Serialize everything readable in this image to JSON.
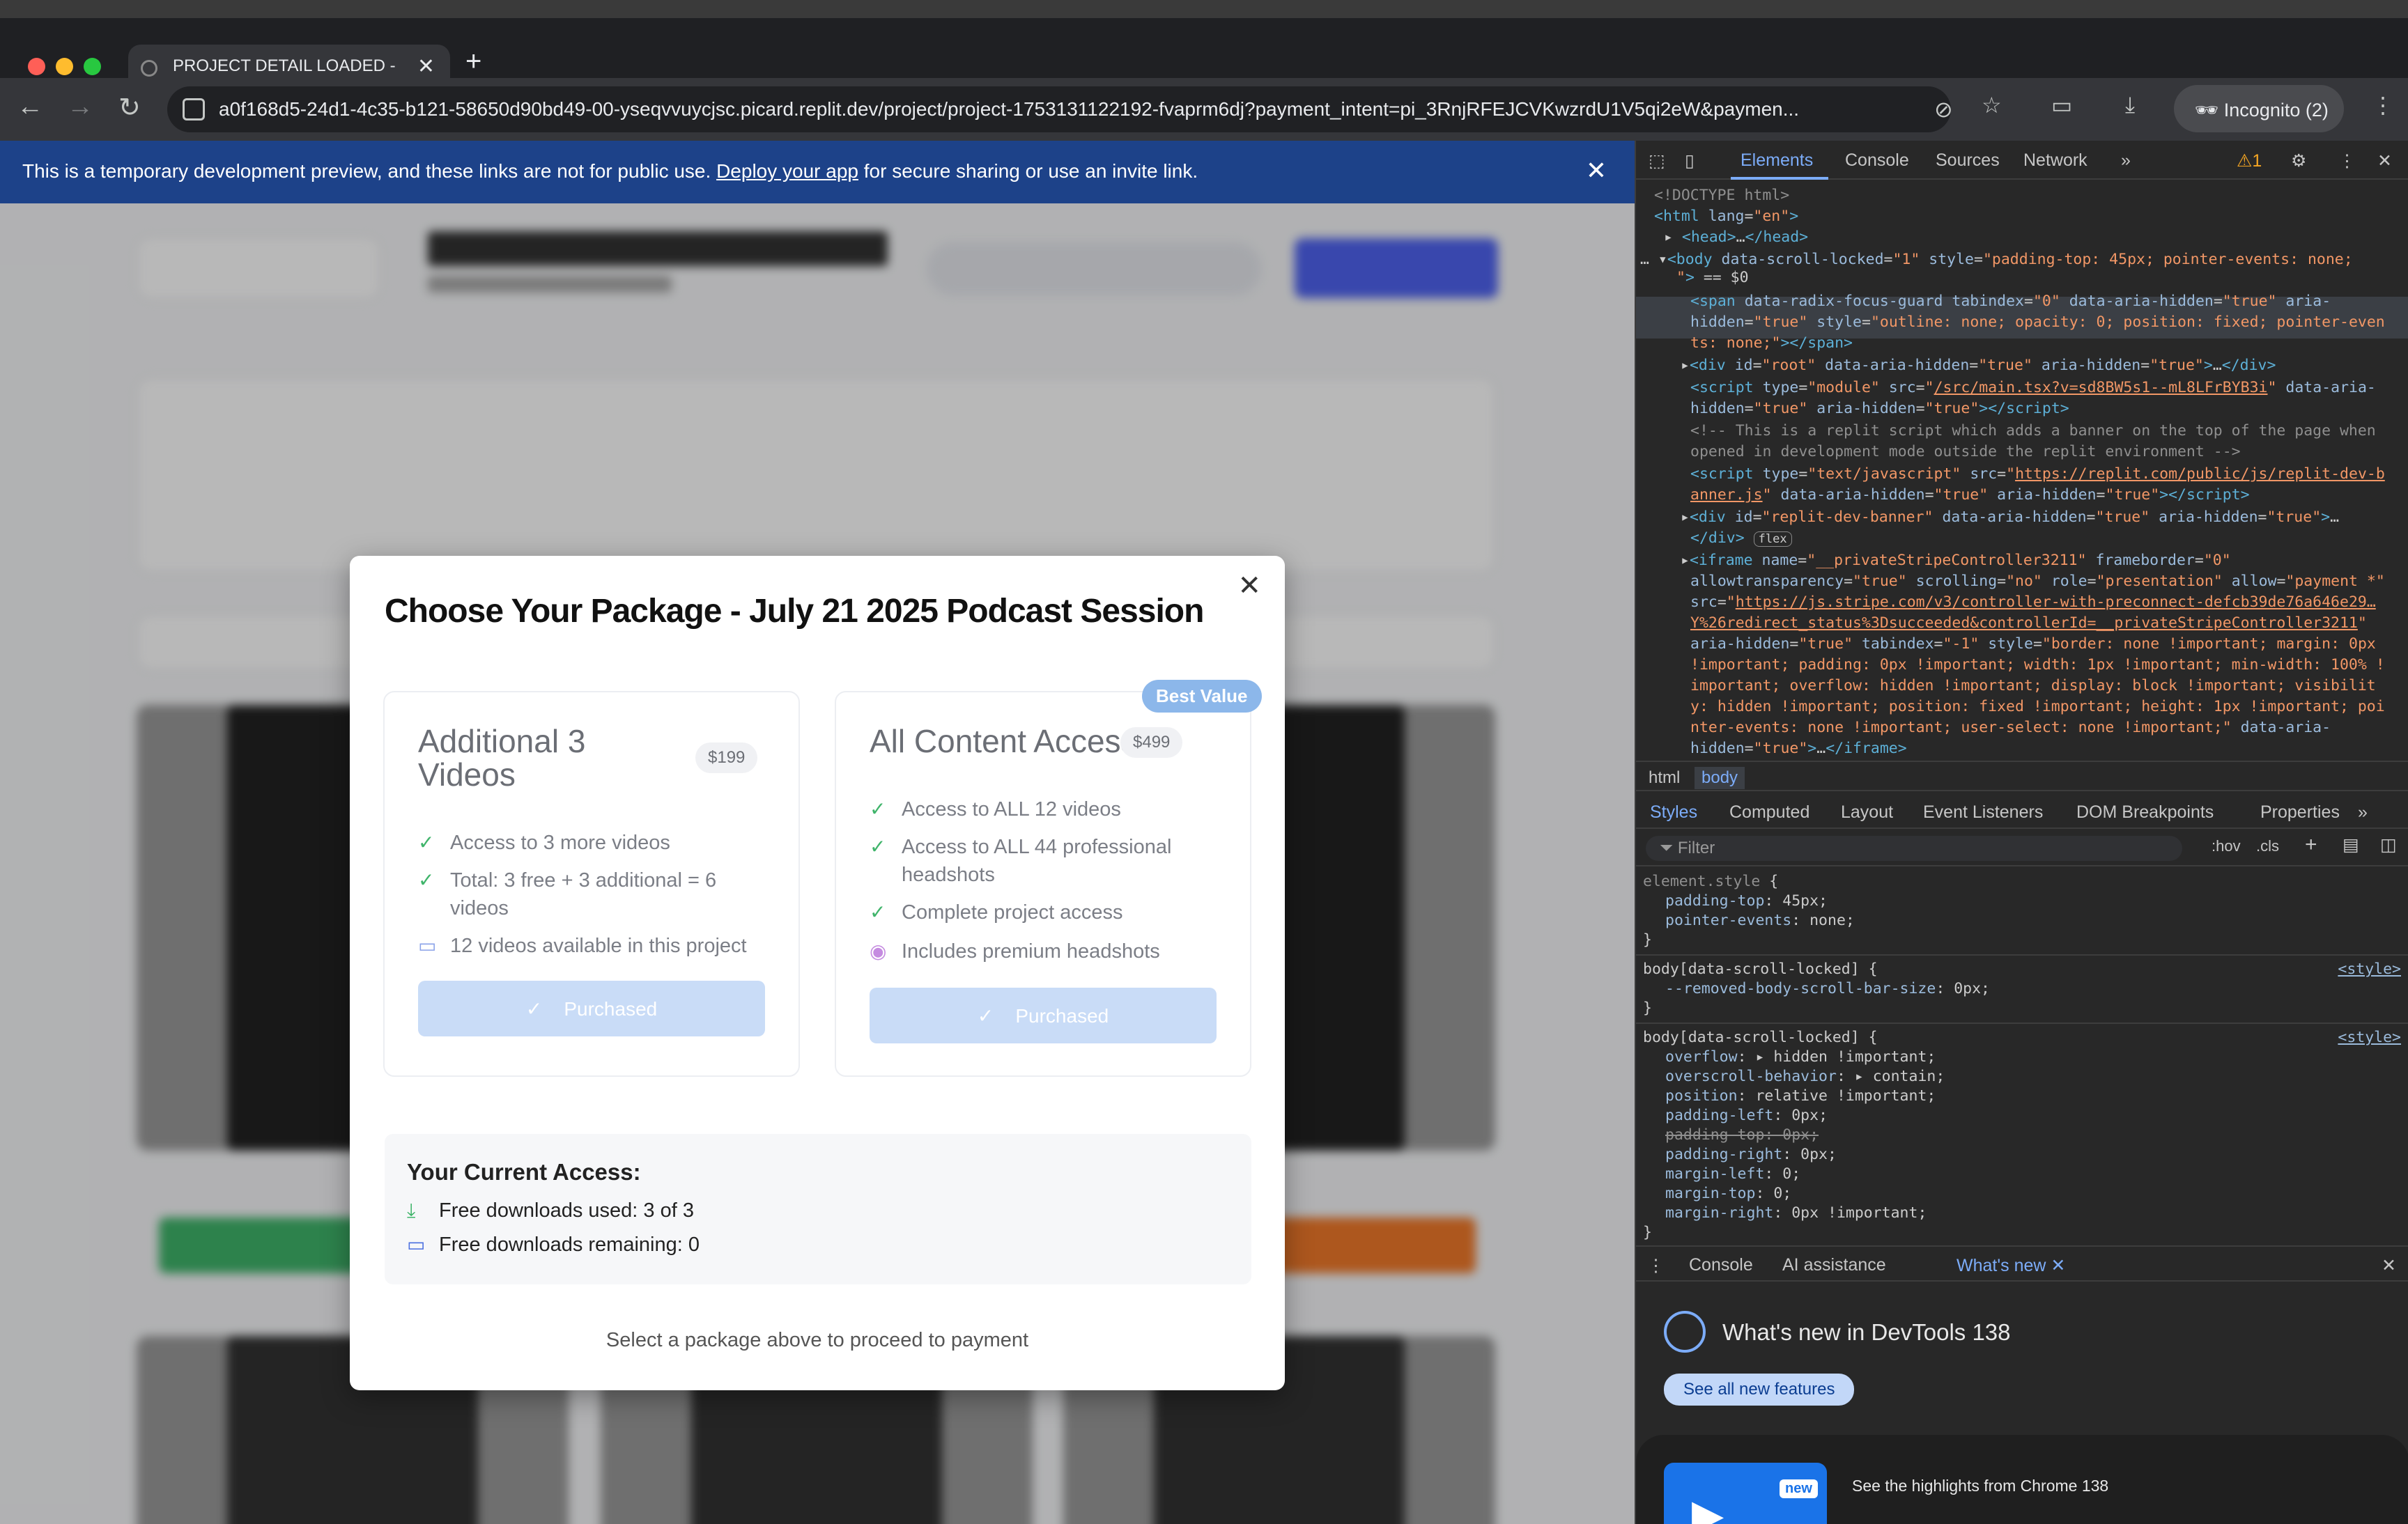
{
  "browser": {
    "tab_title": "PROJECT DETAIL LOADED - /",
    "url": "a0f168d5-24d1-4c35-b121-58650d90bd49-00-yseqvvuycjsc.picard.replit.dev/project/project-1753131122192-fvaprm6dj?payment_intent=pi_3RnjRFEJCVKwzrdU1V5qi2eW&paymen...",
    "profile_label": "Incognito (2)"
  },
  "banner": {
    "text_before": "This is a temporary development preview, and these links are not for public use. ",
    "link": "Deploy your app",
    "text_after": " for secure sharing or use an invite link."
  },
  "modal": {
    "title": "Choose Your Package - July 21 2025 Podcast Session",
    "best_value_badge": "Best Value",
    "packages": [
      {
        "title_line1": "Additional 3",
        "title_line2": "Videos",
        "price": "$199",
        "features": [
          {
            "icon": "check-icon",
            "text": "Access to 3 more videos"
          },
          {
            "icon": "check-icon",
            "text_line1": "Total: 3 free + 3 additional = 6",
            "text_line2": "videos"
          },
          {
            "icon": "video-icon",
            "text": "12 videos available in this project"
          }
        ],
        "button": "Purchased"
      },
      {
        "title_line1": "All Content Access",
        "price": "$499",
        "features": [
          {
            "icon": "check-icon",
            "text": "Access to ALL 12 videos"
          },
          {
            "icon": "check-icon",
            "text_line1": "Access to ALL 44 professional",
            "text_line2": "headshots"
          },
          {
            "icon": "check-icon",
            "text": "Complete project access"
          },
          {
            "icon": "camera-icon",
            "text": "Includes premium headshots"
          }
        ],
        "button": "Purchased"
      }
    ],
    "access": {
      "heading": "Your Current Access:",
      "used": "Free downloads used: 3 of 3",
      "remaining": "Free downloads remaining: 0"
    },
    "select_note": "Select a package above to proceed to payment"
  },
  "devtools": {
    "tabs": [
      "Elements",
      "Console",
      "Sources",
      "Network"
    ],
    "active_tab": "Elements",
    "warning_count": "1",
    "breadcrumbs": [
      "html",
      "body"
    ],
    "style_tabs": [
      "Styles",
      "Computed",
      "Layout",
      "Event Listeners",
      "DOM Breakpoints",
      "Properties"
    ],
    "filter_placeholder": "Filter",
    "filter_hov": ":hov",
    "filter_cls": ".cls",
    "style_source": "<style>",
    "drawer_tabs": [
      "Console",
      "AI assistance",
      "What's new"
    ],
    "whats_new_title": "What's new in DevTools 138",
    "whats_new_button": "See all new features",
    "whats_new_badge": "new",
    "whats_new_highlight": "See the highlights from Chrome 138"
  },
  "colors": {
    "banner_bg": "#1d4289",
    "devtools_accent": "#7cacf8",
    "check": "#3fb46a",
    "purchased_btn": "#c9dcf7"
  }
}
